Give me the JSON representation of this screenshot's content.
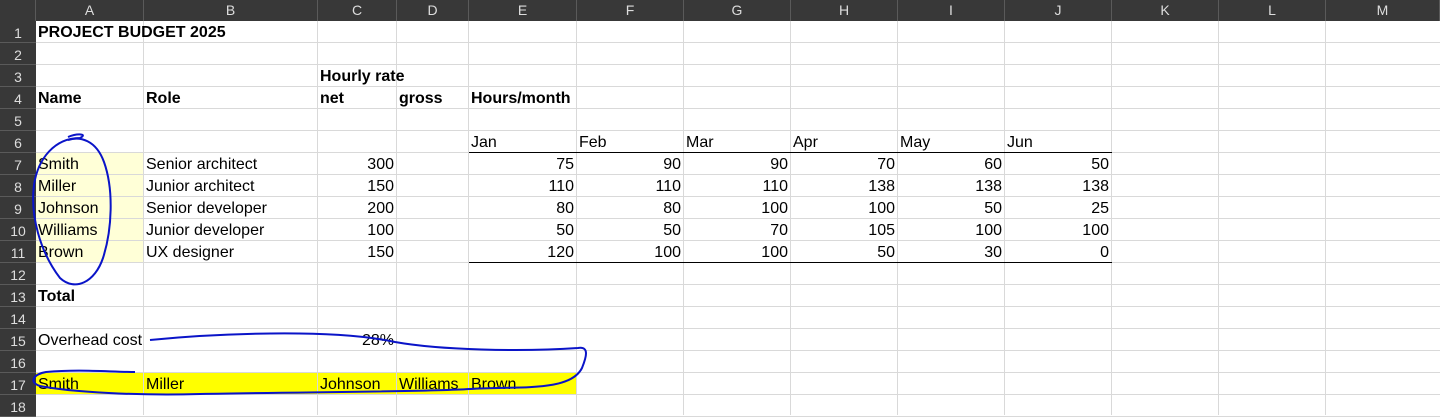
{
  "columns": [
    "A",
    "B",
    "C",
    "D",
    "E",
    "F",
    "G",
    "H",
    "I",
    "J",
    "K",
    "L",
    "M"
  ],
  "rows": [
    "1",
    "2",
    "3",
    "4",
    "5",
    "6",
    "7",
    "8",
    "9",
    "10",
    "11",
    "12",
    "13",
    "14",
    "15",
    "16",
    "17",
    "18"
  ],
  "title": "PROJECT BUDGET 2025",
  "headers": {
    "hourly_rate": "Hourly rate",
    "name": "Name",
    "role": "Role",
    "net": "net",
    "gross": "gross",
    "hours_month": "Hours/month"
  },
  "months": [
    "Jan",
    "Feb",
    "Mar",
    "Apr",
    "May",
    "Jun"
  ],
  "staff": [
    {
      "name": "Smith",
      "role": "Senior architect",
      "rate": "300",
      "hours": [
        "75",
        "90",
        "90",
        "70",
        "60",
        "50"
      ]
    },
    {
      "name": "Miller",
      "role": "Junior architect",
      "rate": "150",
      "hours": [
        "110",
        "110",
        "110",
        "138",
        "138",
        "138"
      ]
    },
    {
      "name": "Johnson",
      "role": "Senior developer",
      "rate": "200",
      "hours": [
        "80",
        "80",
        "100",
        "100",
        "50",
        "25"
      ]
    },
    {
      "name": "Williams",
      "role": "Junior developer",
      "rate": "100",
      "hours": [
        "50",
        "50",
        "70",
        "105",
        "100",
        "100"
      ]
    },
    {
      "name": "Brown",
      "role": "UX designer",
      "rate": "150",
      "hours": [
        "120",
        "100",
        "100",
        "50",
        "30",
        "0"
      ]
    }
  ],
  "total_label": "Total",
  "overhead": {
    "label": "Overhead cost",
    "value": "28%"
  },
  "row17": [
    "Smith",
    "Miller",
    "Johnson",
    "Williams",
    "Brown"
  ],
  "colors": {
    "header_bg": "#383838",
    "name_fill": "#ffffd7",
    "highlight": "#ffff00",
    "ink": "#0a14c8"
  }
}
